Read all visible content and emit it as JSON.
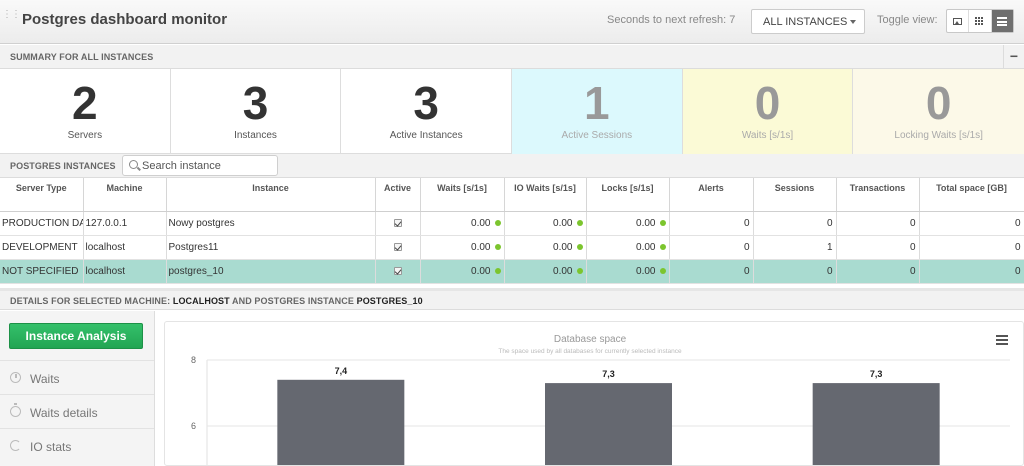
{
  "header": {
    "title": "Postgres dashboard monitor",
    "refresh_text": "Seconds to next refresh: 7",
    "instances_select": "ALL INSTANCES",
    "toggle_label": "Toggle view:"
  },
  "summary": {
    "title": "SUMMARY FOR ALL INSTANCES",
    "collapse_label": "−",
    "stats": [
      {
        "value": "2",
        "label": "Servers"
      },
      {
        "value": "3",
        "label": "Instances"
      },
      {
        "value": "3",
        "label": "Active Instances"
      },
      {
        "value": "1",
        "label": "Active Sessions"
      },
      {
        "value": "0",
        "label": "Waits [s/1s]"
      },
      {
        "value": "0",
        "label": "Locking Waits [s/1s]"
      }
    ]
  },
  "instances": {
    "title": "POSTGRES INSTANCES",
    "search_placeholder": "Search instance",
    "columns": [
      "Server Type",
      "Machine",
      "Instance",
      "Active",
      "Waits [s/1s]",
      "IO Waits [s/1s]",
      "Locks [s/1s]",
      "Alerts",
      "Sessions",
      "Transactions",
      "Total space [GB]"
    ],
    "rows": [
      {
        "server_type": "PRODUCTION DATABASE",
        "machine": "127.0.0.1",
        "instance": "Nowy postgres",
        "waits": "0.00",
        "io_waits": "0.00",
        "locks": "0.00",
        "alerts": "0",
        "sessions": "0",
        "transactions": "0",
        "total_space": "0"
      },
      {
        "server_type": "DEVELOPMENT",
        "machine": "localhost",
        "instance": "Postgres11",
        "waits": "0.00",
        "io_waits": "0.00",
        "locks": "0.00",
        "alerts": "0",
        "sessions": "1",
        "transactions": "0",
        "total_space": "0"
      },
      {
        "server_type": "NOT SPECIFIED",
        "machine": "localhost",
        "instance": "postgres_10",
        "waits": "0.00",
        "io_waits": "0.00",
        "locks": "0.00",
        "alerts": "0",
        "sessions": "0",
        "transactions": "0",
        "total_space": "0"
      }
    ]
  },
  "details": {
    "prefix": "DETAILS FOR SELECTED MACHINE:",
    "machine": "LOCALHOST",
    "middle": "AND POSTGRES INSTANCE",
    "instance": "POSTGRES_10"
  },
  "sidebar": {
    "analysis_button": "Instance Analysis",
    "items": [
      {
        "label": "Waits",
        "icon": "clock-icon"
      },
      {
        "label": "Waits details",
        "icon": "stopwatch-icon"
      },
      {
        "label": "IO stats",
        "icon": "spinner-icon"
      }
    ]
  },
  "colors": {
    "accent_green": "#27ae5a",
    "selected_row": "#a9dbd0",
    "status_dot": "#7cc52e",
    "bar": "#656870"
  },
  "chart_data": {
    "type": "bar",
    "title": "Database space",
    "subtitle": "The space used by all databases for currently selected instance",
    "values": [
      7.4,
      7.3,
      7.3
    ],
    "data_labels": [
      "7,4",
      "7,3",
      "7,3"
    ],
    "y_ticks": [
      "8",
      "6"
    ],
    "ylim": [
      5,
      8
    ]
  }
}
